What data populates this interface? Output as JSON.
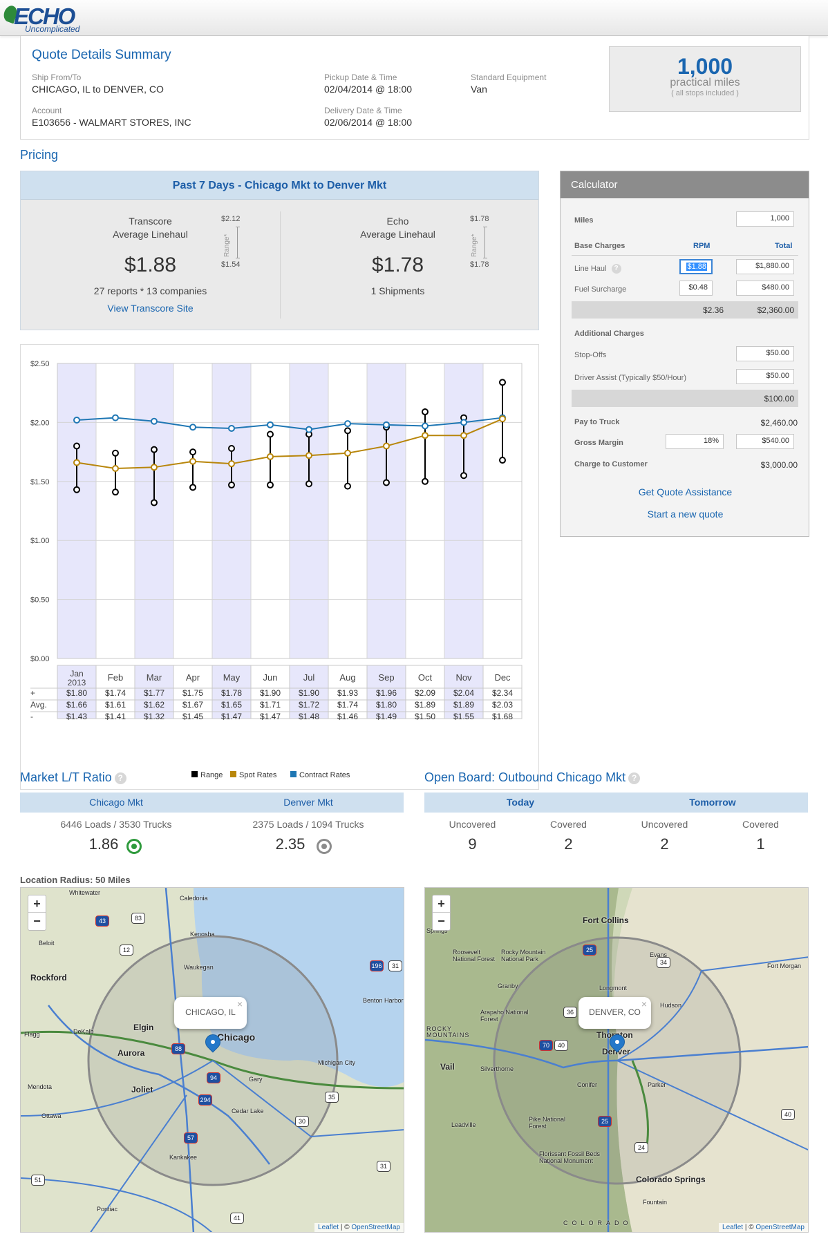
{
  "header": {
    "logo_text": "ECHO",
    "logo_tagline": "Uncomplicated"
  },
  "summary": {
    "title": "Quote Details Summary",
    "ship_label": "Ship From/To",
    "ship_value": "CHICAGO, IL to DENVER, CO",
    "account_label": "Account",
    "account_value": "E103656 - WALMART STORES, INC",
    "pickup_label": "Pickup Date & Time",
    "pickup_value": "02/04/2014 @ 18:00",
    "delivery_label": "Delivery Date & Time",
    "delivery_value": "02/06/2014 @ 18:00",
    "equipment_label": "Standard Equipment",
    "equipment_value": "Van",
    "miles_value": "1,000",
    "miles_unit": "practical miles",
    "miles_note": "( all stops included )"
  },
  "pricing": {
    "title": "Pricing",
    "panel_title": "Past 7 Days - Chicago Mkt to Denver Mkt",
    "range_label": "Range*",
    "transcore": {
      "name": "Transcore",
      "label": "Average Linehaul",
      "value": "$1.88",
      "high": "$2.12",
      "low": "$1.54",
      "reports": "27 reports * 13 companies",
      "link": "View Transcore Site"
    },
    "echo": {
      "name": "Echo",
      "label": "Average Linehaul",
      "value": "$1.78",
      "high": "$1.78",
      "low": "$1.78",
      "shipments": "1 Shipments"
    }
  },
  "chart_data": {
    "type": "line",
    "title": "",
    "xlabel": "",
    "ylabel": "",
    "ylim": [
      0,
      2.5
    ],
    "y_ticks": [
      "$0.00",
      "$0.50",
      "$1.00",
      "$1.50",
      "$2.00",
      "$2.50"
    ],
    "categories": [
      "Jan 2013",
      "Feb",
      "Mar",
      "Apr",
      "May",
      "Jun",
      "Jul",
      "Aug",
      "Sep",
      "Oct",
      "Nov",
      "Dec"
    ],
    "series": [
      {
        "name": "Contract Rates",
        "color": "#1f77b4",
        "values": [
          2.02,
          2.04,
          2.01,
          1.96,
          1.95,
          1.98,
          1.94,
          1.99,
          1.98,
          1.97,
          2.0,
          2.04
        ]
      },
      {
        "name": "Spot Rates",
        "color": "#b8860b",
        "values": [
          1.66,
          1.61,
          1.62,
          1.67,
          1.65,
          1.71,
          1.72,
          1.74,
          1.8,
          1.89,
          1.89,
          2.03
        ]
      },
      {
        "name": "Range",
        "color": "#000000",
        "high": [
          1.8,
          1.74,
          1.77,
          1.75,
          1.78,
          1.9,
          1.9,
          1.93,
          1.96,
          2.09,
          2.04,
          2.34
        ],
        "low": [
          1.43,
          1.41,
          1.32,
          1.45,
          1.47,
          1.47,
          1.48,
          1.46,
          1.49,
          1.5,
          1.55,
          1.68
        ]
      }
    ],
    "table_row_labels": [
      "+",
      "Avg.",
      "-"
    ],
    "table": {
      "plus": [
        "$1.80",
        "$1.74",
        "$1.77",
        "$1.75",
        "$1.78",
        "$1.90",
        "$1.90",
        "$1.93",
        "$1.96",
        "$2.09",
        "$2.04",
        "$2.34"
      ],
      "avg": [
        "$1.66",
        "$1.61",
        "$1.62",
        "$1.67",
        "$1.65",
        "$1.71",
        "$1.72",
        "$1.74",
        "$1.80",
        "$1.89",
        "$1.89",
        "$2.03"
      ],
      "minus": [
        "$1.43",
        "$1.41",
        "$1.32",
        "$1.45",
        "$1.47",
        "$1.47",
        "$1.48",
        "$1.46",
        "$1.49",
        "$1.50",
        "$1.55",
        "$1.68"
      ]
    },
    "legend": [
      "Range",
      "Spot Rates",
      "Contract Rates"
    ],
    "legend_colors": [
      "#000000",
      "#b8860b",
      "#1f77b4"
    ],
    "legend_position": "bottom"
  },
  "calculator": {
    "title": "Calculator",
    "miles_label": "Miles",
    "miles_value": "1,000",
    "base_label": "Base Charges",
    "rpm_label": "RPM",
    "total_label": "Total",
    "linehaul_label": "Line Haul",
    "linehaul_rpm": "$1.88",
    "linehaul_total": "$1,880.00",
    "fuel_label": "Fuel Surcharge",
    "fuel_rpm": "$0.48",
    "fuel_total": "$480.00",
    "base_sum_rpm": "$2.36",
    "base_sum_total": "$2,360.00",
    "additional_label": "Additional Charges",
    "stopoffs_label": "Stop-Offs",
    "stopoffs_value": "$50.00",
    "driver_label": "Driver Assist (Typically $50/Hour)",
    "driver_value": "$50.00",
    "additional_sum": "$100.00",
    "pay_label": "Pay to Truck",
    "pay_value": "$2,460.00",
    "margin_label": "Gross Margin",
    "margin_pct": "18%",
    "margin_value": "$540.00",
    "charge_label": "Charge to Customer",
    "charge_value": "$3,000.00",
    "assist_link": "Get Quote Assistance",
    "new_quote_link": "Start a new quote"
  },
  "ratio": {
    "title": "Market L/T Ratio",
    "chicago_tab": "Chicago Mkt",
    "denver_tab": "Denver Mkt",
    "chicago_stats": "6446 Loads / 3530 Trucks",
    "denver_stats": "2375 Loads / 1094 Trucks",
    "chicago_ratio": "1.86",
    "denver_ratio": "2.35"
  },
  "board": {
    "title": "Open Board: Outbound Chicago Mkt",
    "today_tab": "Today",
    "tomorrow_tab": "Tomorrow",
    "cols": [
      "Uncovered",
      "Covered",
      "Uncovered",
      "Covered"
    ],
    "values": [
      "9",
      "2",
      "2",
      "1"
    ]
  },
  "maps": {
    "radius_label": "Location Radius: 50 Miles",
    "attribution_leaflet": "Leaflet",
    "attribution_sep": " | © ",
    "attribution_osm": "OpenStreetMap",
    "chicago": {
      "popup": "CHICAGO, IL",
      "labels": [
        "Whitewater",
        "Caledonia",
        "Kenosha",
        "Waukegan",
        "Beloit",
        "Rockford",
        "Elgin",
        "DeKalb",
        "Aurora",
        "Chicago",
        "Joliet",
        "Gary",
        "Mendota",
        "Ottawa",
        "Kankakee",
        "Pontiac",
        "Cedar Lake",
        "Michigan City",
        "Benton Harbor",
        "Flagg"
      ],
      "shields": [
        "43",
        "83",
        "12",
        "196",
        "31",
        "88",
        "94",
        "294",
        "57",
        "35",
        "30",
        "31",
        "51",
        "41"
      ]
    },
    "denver": {
      "popup": "DENVER, CO",
      "labels": [
        "Fort Collins",
        "Evans",
        "Fort Morgan",
        "Longmont",
        "Hudson",
        "Thornton",
        "Denver",
        "Vail",
        "Silverthorne",
        "Conifer",
        "Parker",
        "Leadville",
        "Colorado Springs",
        "Fountain",
        "Springs",
        "Granby",
        "Roosevelt National Forest",
        "Rocky Mountain National Park",
        "Arapaho National Forest",
        "Pike National Forest",
        "Florissant Fossil Beds National Monument",
        "COLORADO",
        "ROCKY MOUNTAINS"
      ],
      "shields": [
        "25",
        "34",
        "36",
        "70",
        "40",
        "25",
        "24",
        "40"
      ]
    }
  }
}
